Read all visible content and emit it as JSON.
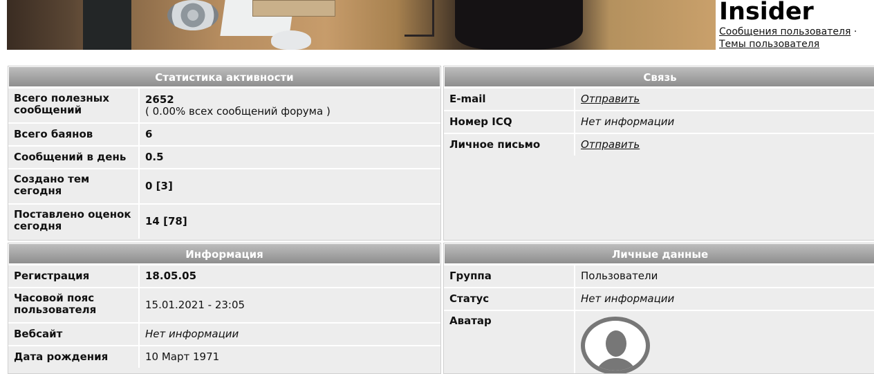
{
  "header": {
    "username": "Insider",
    "links": [
      {
        "label": "Сообщения пользователя"
      },
      {
        "label": "Темы пользователя"
      }
    ],
    "separator": "·"
  },
  "stats": {
    "title": "Статистика активности",
    "rows": [
      {
        "label": "Всего полезных сообщений",
        "value": "2652",
        "sub": "( 0.00% всех сообщений форума )"
      },
      {
        "label": "Всего баянов",
        "value": "6"
      },
      {
        "label": "Сообщений в день",
        "value": "0.5"
      },
      {
        "label": "Создано тем сегодня",
        "value": "0 [3]"
      },
      {
        "label": "Поставлено оценок сегодня",
        "value": "14 [78]"
      }
    ]
  },
  "contact": {
    "title": "Связь",
    "rows": [
      {
        "label": "E-mail",
        "value": "Отправить"
      },
      {
        "label": "Номер ICQ",
        "value": "Нет информации"
      },
      {
        "label": "Личное письмо",
        "value": "Отправить"
      }
    ]
  },
  "info": {
    "title": "Информация",
    "rows": [
      {
        "label": "Регистрация",
        "value": "18.05.05"
      },
      {
        "label": "Часовой пояс пользователя",
        "value": "15.01.2021 - 23:05"
      },
      {
        "label": "Вебсайт",
        "value": "Нет информации"
      },
      {
        "label": "Дата рождения",
        "value": "10 Март 1971"
      }
    ]
  },
  "personal": {
    "title": "Личные данные",
    "rows": [
      {
        "label": "Группа",
        "value": "Пользователи"
      },
      {
        "label": "Статус",
        "value": "Нет информации"
      },
      {
        "label": "Аватар",
        "icon": "user-silhouette-icon"
      }
    ]
  },
  "colors": {
    "panel_bg": "#ededed",
    "header_gradient_top": "#bdbdbd",
    "header_gradient_bottom": "#8e8e8e",
    "avatar_gray": "#777777"
  }
}
